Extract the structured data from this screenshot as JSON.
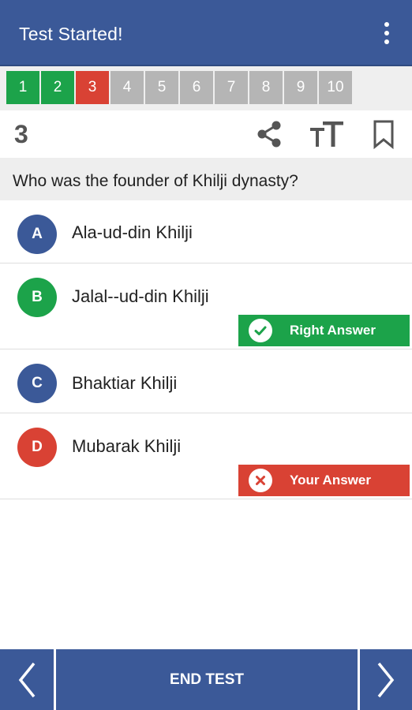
{
  "appbar": {
    "title": "Test Started!"
  },
  "question_nav": [
    {
      "label": "1",
      "state": "right"
    },
    {
      "label": "2",
      "state": "right"
    },
    {
      "label": "3",
      "state": "wrong"
    },
    {
      "label": "4",
      "state": "pending"
    },
    {
      "label": "5",
      "state": "pending"
    },
    {
      "label": "6",
      "state": "pending"
    },
    {
      "label": "7",
      "state": "pending"
    },
    {
      "label": "8",
      "state": "pending"
    },
    {
      "label": "9",
      "state": "pending"
    },
    {
      "label": "10",
      "state": "pending"
    }
  ],
  "current": {
    "index": "3",
    "question": "Who was the founder of Khilji dynasty?",
    "options": [
      {
        "letter": "A",
        "text": "Ala-ud-din Khilji",
        "color": "#3b5998"
      },
      {
        "letter": "B",
        "text": "Jalal--ud-din Khilji",
        "color": "#1ca34a"
      },
      {
        "letter": "C",
        "text": "Bhaktiar Khilji",
        "color": "#3b5998"
      },
      {
        "letter": "D",
        "text": "Mubarak Khilji",
        "color": "#d94234"
      }
    ],
    "right_answer_label": "Right Answer",
    "your_answer_label": "Your Answer"
  },
  "icons": {
    "share": "share-icon",
    "text_size": "text-size-icon",
    "bookmark": "bookmark-icon",
    "prev": "chevron-left-icon",
    "next": "chevron-right-icon",
    "menu": "more-vert-icon"
  },
  "colors": {
    "primary": "#3b5998",
    "right": "#1ca34a",
    "wrong": "#d94234",
    "pending": "#b5b5b5"
  },
  "footer": {
    "end_test_label": "END TEST"
  }
}
